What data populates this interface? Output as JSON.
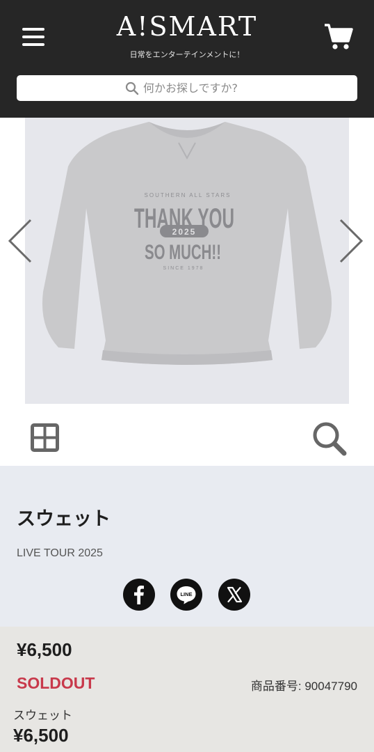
{
  "header": {
    "logo_text": "A!SMART",
    "tagline": "日常をエンターテインメントに！",
    "search_placeholder": "何かお探しですか?",
    "menu_icon": "hamburger-menu-icon",
    "cart_icon": "shopping-cart-icon"
  },
  "gallery": {
    "print_line_top": "SOUTHERN ALL STARS",
    "print_line_1": "THANK YOU",
    "print_badge": "2025",
    "print_line_2": "SO MUCH!!",
    "print_line_bottom": "SINCE 1978",
    "prev_icon": "chevron-left-icon",
    "next_icon": "chevron-right-icon",
    "grid_icon": "grid-view-icon",
    "zoom_icon": "zoom-icon"
  },
  "product": {
    "title": "スウェット",
    "subtitle": "LIVE TOUR 2025",
    "share": [
      "facebook-icon",
      "line-icon",
      "x-icon"
    ]
  },
  "pricing": {
    "price": "¥6,500",
    "status": "SOLDOUT",
    "sku": "商品番号: 90047790",
    "variant_name": "スウェット",
    "variant_price": "¥6,500"
  },
  "colors": {
    "header_bg": "#262626",
    "info_bg": "#e8ebf1",
    "price_bg": "#e7e6e3",
    "soldout": "#c8394b"
  }
}
